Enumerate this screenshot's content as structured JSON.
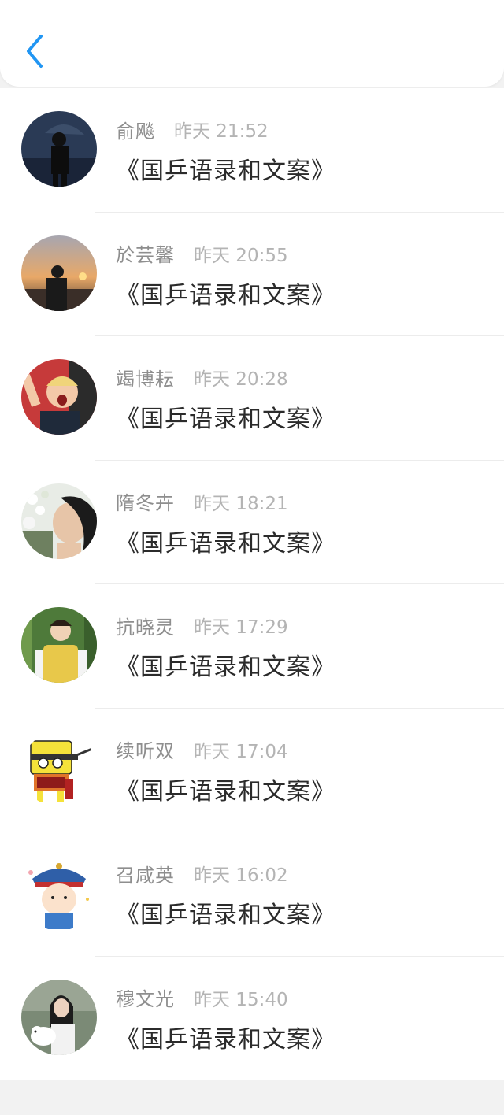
{
  "colors": {
    "accent": "#2196f3",
    "name_text": "#8e8e8e",
    "time_text": "#b4b4b4",
    "message_text": "#2b2b2b",
    "background": "#f2f2f2"
  },
  "header": {
    "back_icon": "chevron-left-icon"
  },
  "items": [
    {
      "name": "俞飚",
      "time": "昨天 21:52",
      "message": "《国乒语录和文案》"
    },
    {
      "name": "於芸馨",
      "time": "昨天 20:55",
      "message": "《国乒语录和文案》"
    },
    {
      "name": "竭博耘",
      "time": "昨天 20:28",
      "message": "《国乒语录和文案》"
    },
    {
      "name": "隋冬卉",
      "time": "昨天 18:21",
      "message": "《国乒语录和文案》"
    },
    {
      "name": "抗晓灵",
      "time": "昨天 17:29",
      "message": "《国乒语录和文案》"
    },
    {
      "name": "续听双",
      "time": "昨天 17:04",
      "message": "《国乒语录和文案》"
    },
    {
      "name": "召咸英",
      "time": "昨天 16:02",
      "message": "《国乒语录和文案》"
    },
    {
      "name": "穆文光",
      "time": "昨天 15:40",
      "message": "《国乒语录和文案》"
    }
  ]
}
